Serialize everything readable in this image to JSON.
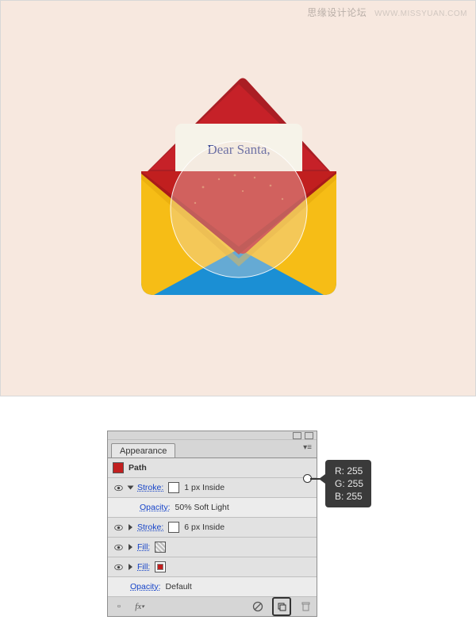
{
  "watermark": {
    "cn": "思缘设计论坛",
    "en": "WWW.MISSYUAN.COM"
  },
  "letter_text": "Dear Santa,",
  "panel": {
    "tab": "Appearance",
    "item_label": "Path",
    "rows": [
      {
        "type": "stroke",
        "label": "Stroke:",
        "value": "1 px  Inside",
        "open": true
      },
      {
        "type": "opacity",
        "label": "Opacity:",
        "value": "50% Soft Light"
      },
      {
        "type": "stroke",
        "label": "Stroke:",
        "value": "6 px  Inside",
        "open": false
      },
      {
        "type": "fill",
        "label": "Fill:",
        "swatch": "hatch",
        "open": false
      },
      {
        "type": "fill",
        "label": "Fill:",
        "swatch": "#c11f1f",
        "open": false
      },
      {
        "type": "opacity",
        "label": "Opacity:",
        "value": "Default"
      }
    ]
  },
  "tooltip": {
    "r": "R: 255",
    "g": "G: 255",
    "b": "B: 255"
  }
}
